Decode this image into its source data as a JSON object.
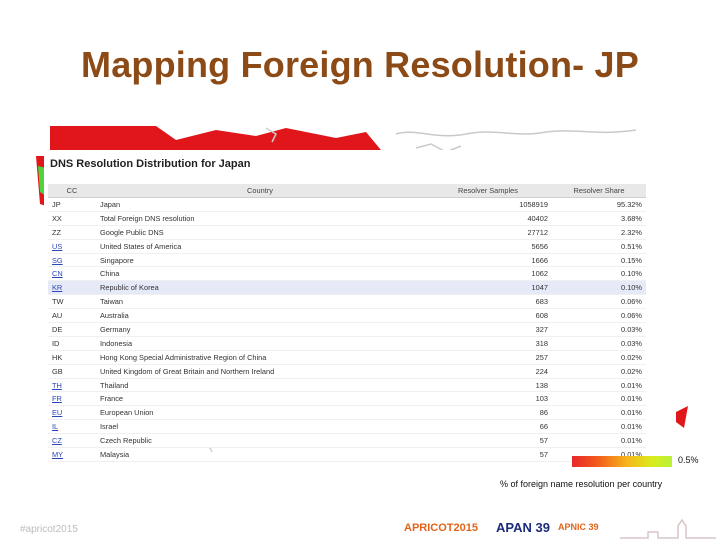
{
  "slide": {
    "title": "Mapping Foreign Resolution- JP",
    "hashtag": "#apricot2015"
  },
  "panel": {
    "title": "DNS Resolution Distribution for Japan",
    "columns": [
      "CC",
      "Country",
      "Resolver Samples",
      "Resolver Share"
    ],
    "rows": [
      {
        "cc": "JP",
        "link": false,
        "country": "Japan",
        "samples": "1058919",
        "share": "95.32%"
      },
      {
        "cc": "XX",
        "link": false,
        "country": "Total Foreign DNS resolution",
        "samples": "40402",
        "share": "3.68%"
      },
      {
        "cc": "ZZ",
        "link": false,
        "country": "Google Public DNS",
        "samples": "27712",
        "share": "2.32%"
      },
      {
        "cc": "US",
        "link": true,
        "country": "United States of America",
        "samples": "5656",
        "share": "0.51%"
      },
      {
        "cc": "SG",
        "link": true,
        "country": "Singapore",
        "samples": "1666",
        "share": "0.15%"
      },
      {
        "cc": "CN",
        "link": true,
        "country": "China",
        "samples": "1062",
        "share": "0.10%"
      },
      {
        "cc": "KR",
        "link": true,
        "country": "Republic of Korea",
        "samples": "1047",
        "share": "0.10%"
      },
      {
        "cc": "TW",
        "link": false,
        "country": "Taiwan",
        "samples": "683",
        "share": "0.06%"
      },
      {
        "cc": "AU",
        "link": false,
        "country": "Australia",
        "samples": "608",
        "share": "0.06%"
      },
      {
        "cc": "DE",
        "link": false,
        "country": "Germany",
        "samples": "327",
        "share": "0.03%"
      },
      {
        "cc": "ID",
        "link": false,
        "country": "Indonesia",
        "samples": "318",
        "share": "0.03%"
      },
      {
        "cc": "HK",
        "link": false,
        "country": "Hong Kong Special Administrative Region of China",
        "samples": "257",
        "share": "0.02%"
      },
      {
        "cc": "GB",
        "link": false,
        "country": "United Kingdom of Great Britain and Northern Ireland",
        "samples": "224",
        "share": "0.02%"
      },
      {
        "cc": "TH",
        "link": true,
        "country": "Thailand",
        "samples": "138",
        "share": "0.01%"
      },
      {
        "cc": "FR",
        "link": true,
        "country": "France",
        "samples": "103",
        "share": "0.01%"
      },
      {
        "cc": "EU",
        "link": true,
        "country": "European Union",
        "samples": "86",
        "share": "0.01%"
      },
      {
        "cc": "IL",
        "link": true,
        "country": "Israel",
        "samples": "66",
        "share": "0.01%"
      },
      {
        "cc": "CZ",
        "link": true,
        "country": "Czech Republic",
        "samples": "57",
        "share": "0.01%"
      },
      {
        "cc": "MY",
        "link": true,
        "country": "Malaysia",
        "samples": "57",
        "share": "0.01%"
      }
    ]
  },
  "legend": {
    "max_value": "0.5%",
    "caption": "% of foreign name resolution per country",
    "colors": [
      "#e8282a",
      "#f25a1c",
      "#f7b51c",
      "#d9ec1c",
      "#b8f23a"
    ]
  },
  "footer": {
    "logos": [
      "APRICOT2015",
      "APAN 39",
      "APNIC 39"
    ]
  },
  "colors": {
    "title": "#8B4A16",
    "map_red": "#e0161b",
    "link": "#2a46b8"
  }
}
